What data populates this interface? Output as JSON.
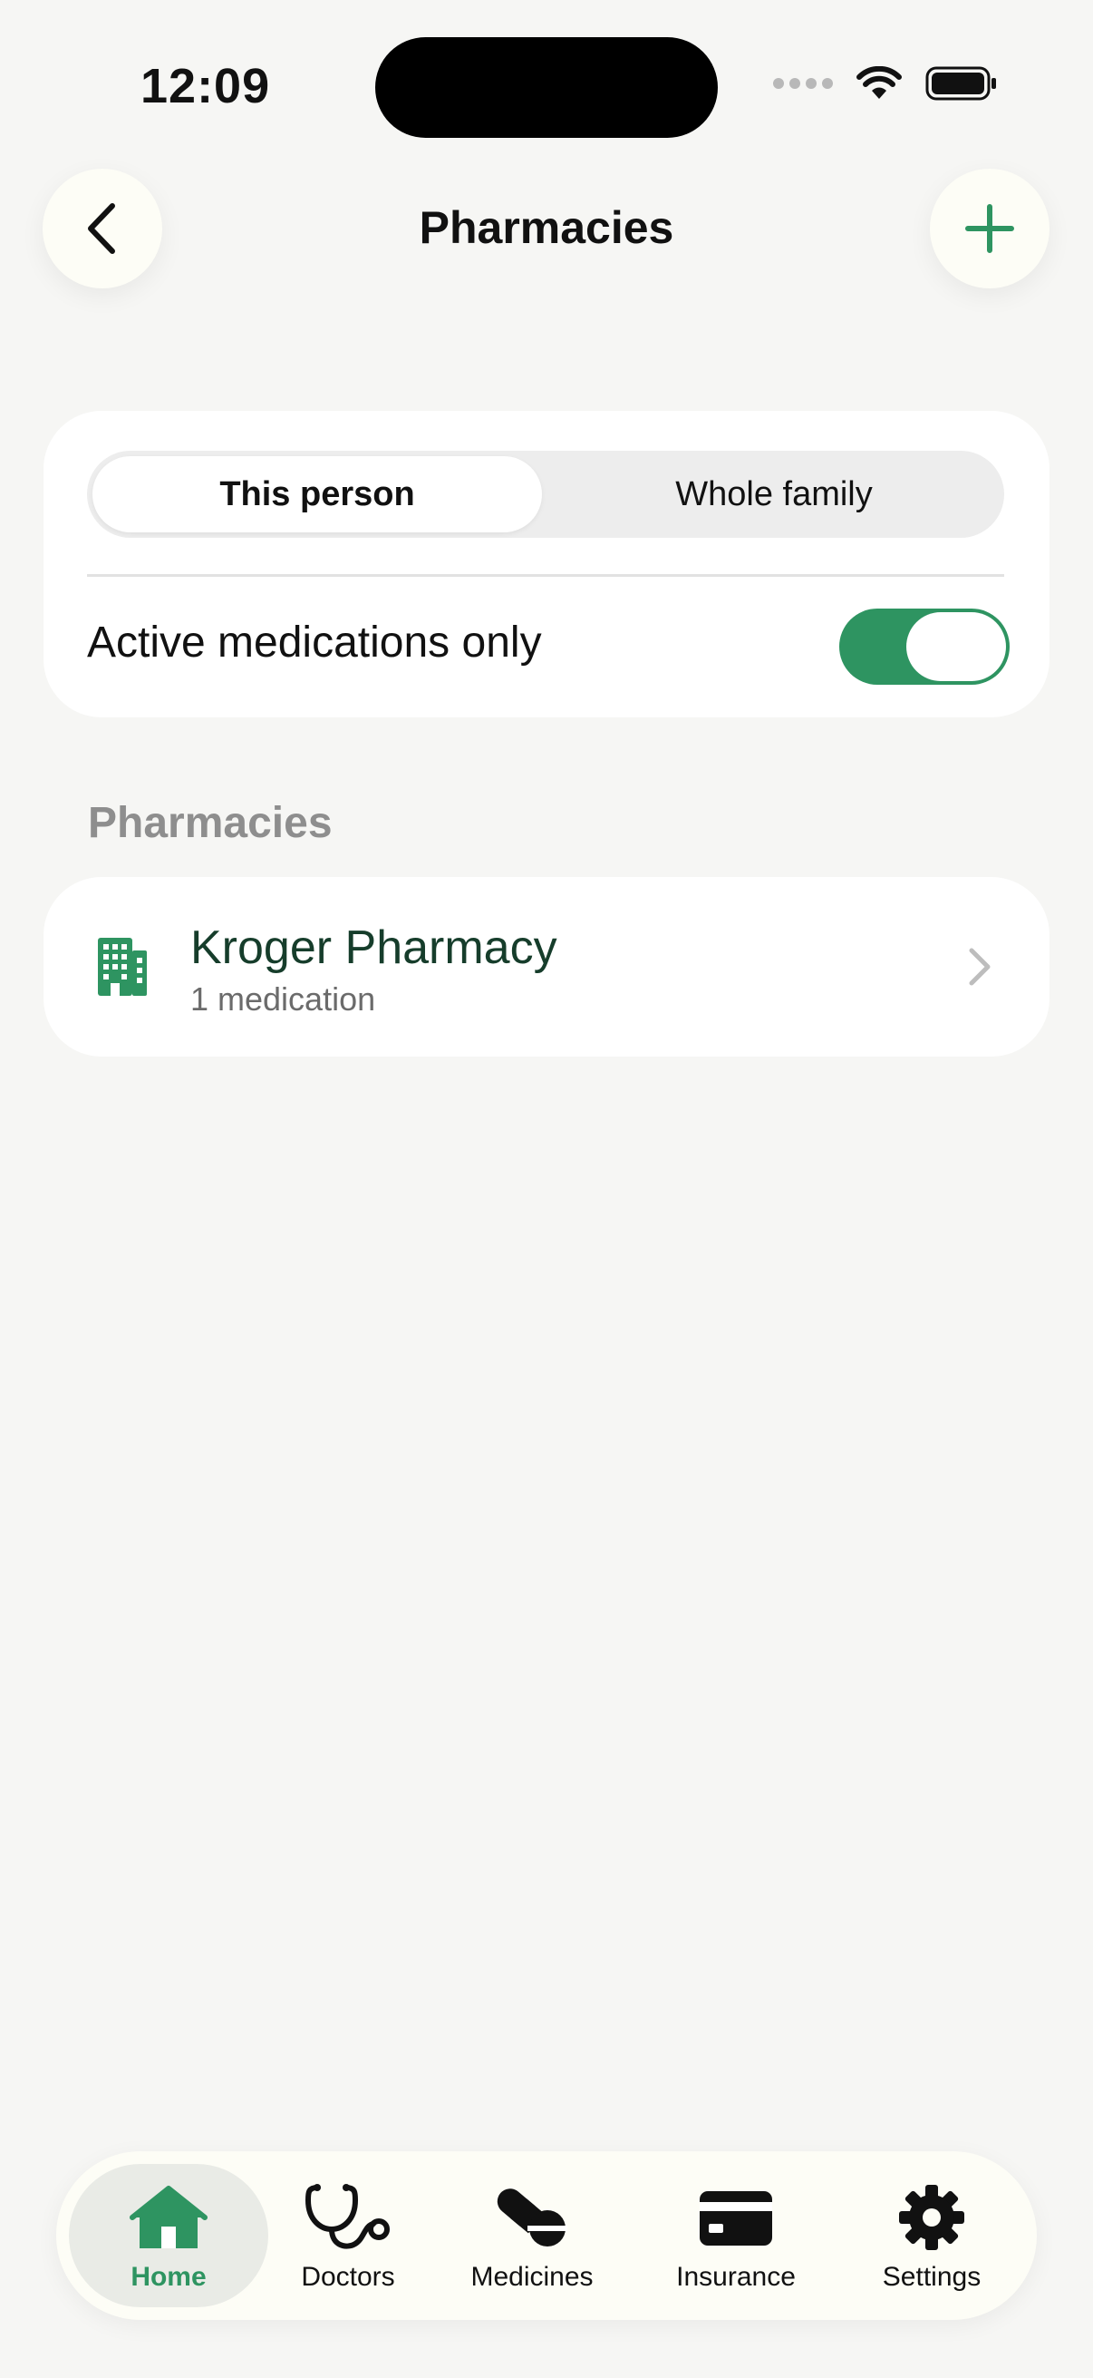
{
  "status_bar": {
    "time": "12:09"
  },
  "header": {
    "title": "Pharmacies",
    "back_icon": "chevron-left-icon",
    "add_icon": "plus-icon"
  },
  "filters": {
    "segments": [
      {
        "label": "This person",
        "selected": true
      },
      {
        "label": "Whole family",
        "selected": false
      }
    ],
    "toggle_label": "Active medications only",
    "toggle_on": true
  },
  "section": {
    "title": "Pharmacies"
  },
  "pharmacies": [
    {
      "name": "Kroger Pharmacy",
      "subtitle": "1 medication",
      "icon": "building-icon"
    }
  ],
  "tab_bar": {
    "tabs": [
      {
        "label": "Home",
        "icon": "house-icon",
        "active": true
      },
      {
        "label": "Doctors",
        "icon": "stethoscope-icon",
        "active": false
      },
      {
        "label": "Medicines",
        "icon": "pills-icon",
        "active": false
      },
      {
        "label": "Insurance",
        "icon": "credit-card-icon",
        "active": false
      },
      {
        "label": "Settings",
        "icon": "gear-icon",
        "active": false
      }
    ]
  },
  "colors": {
    "accent": "#2E9461",
    "background": "#F6F6F4",
    "card": "#FFFFFF",
    "section_title": "#8E8E8E"
  }
}
